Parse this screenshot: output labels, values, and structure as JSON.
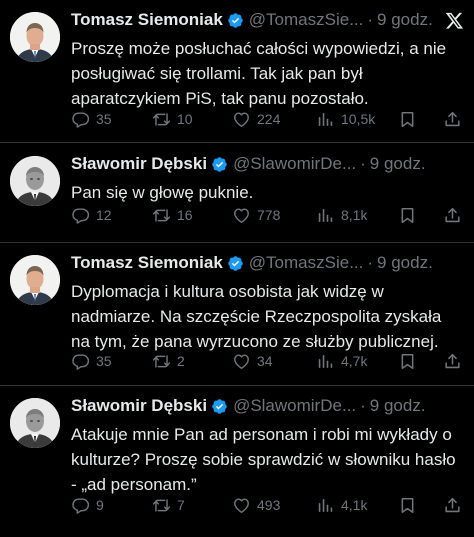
{
  "tweets": [
    {
      "author": "Tomasz Siemoniak",
      "handle": "@TomaszSie...",
      "time": "9 godz.",
      "text": "Proszę może posłuchać całości wypowiedzi, a nie posługiwać się trollami. Tak jak pan był aparatczykiem PiS, tak panu pozostało.",
      "replies": "35",
      "reposts": "10",
      "likes": "224",
      "views": "10,5k"
    },
    {
      "author": "Sławomir Dębski",
      "handle": "@SlawomirDe...",
      "time": "9 godz.",
      "text": "Pan się w głowę puknie.",
      "replies": "12",
      "reposts": "16",
      "likes": "778",
      "views": "8,1k"
    },
    {
      "author": "Tomasz Siemoniak",
      "handle": "@TomaszSie...",
      "time": "9 godz.",
      "text": "Dyplomacja i kultura osobista jak widzę w nadmiarze. Na szczęście Rzeczpospolita zyskała na tym, że pana wyrzucono ze służby publicznej.",
      "replies": "35",
      "reposts": "2",
      "likes": "34",
      "views": "4,7k"
    },
    {
      "author": "Sławomir Dębski",
      "handle": "@SlawomirDe...",
      "time": "9 godz.",
      "text": "Atakuje mnie Pan ad personam i robi mi wykłady o kulturze? Proszę sobie sprawdzić w słowniku hasło - „ad personam.”",
      "replies": "9",
      "reposts": "7",
      "likes": "493",
      "views": "4,1k"
    }
  ],
  "separator": "·",
  "icons": {
    "verified": "verified-badge-icon",
    "x_logo": "x-logo-icon",
    "reply": "reply-icon",
    "repost": "repost-icon",
    "like": "heart-icon",
    "views": "views-icon",
    "bookmark": "bookmark-icon",
    "share": "share-icon"
  },
  "colors": {
    "background": "#000000",
    "text": "#e7e9ea",
    "muted": "#71767b",
    "verified": "#1d9bf0"
  }
}
